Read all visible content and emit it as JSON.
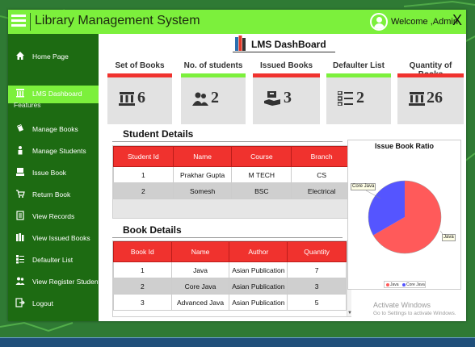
{
  "app": {
    "title": "Library Management System",
    "welcome": "Welcome ,Admin",
    "close": "X"
  },
  "sidebar": {
    "features_label": "Features",
    "items": [
      {
        "label": "Home Page",
        "icon": "home-icon"
      },
      {
        "label": "LMS Dashboard",
        "icon": "library-icon",
        "active": true
      },
      {
        "label": "Manage Books",
        "icon": "book-icon"
      },
      {
        "label": "Manage Students",
        "icon": "student-icon"
      },
      {
        "label": "Issue Book",
        "icon": "issue-icon"
      },
      {
        "label": "Return Book",
        "icon": "cart-icon"
      },
      {
        "label": "View Records",
        "icon": "records-icon"
      },
      {
        "label": "View Issued Books",
        "icon": "books-icon"
      },
      {
        "label": "Defaulter List",
        "icon": "list-icon"
      },
      {
        "label": "View Register Students",
        "icon": "users-icon"
      },
      {
        "label": "Logout",
        "icon": "logout-icon"
      }
    ]
  },
  "dashboard": {
    "title": "LMS  DashBoard"
  },
  "cards": [
    {
      "title": "Set of Books",
      "value": "6",
      "bar_color": "#f0322e",
      "icon": "library-icon"
    },
    {
      "title": "No. of students",
      "value": "2",
      "bar_color": "#7cf03c",
      "icon": "users-icon"
    },
    {
      "title": "Issued Books",
      "value": "3",
      "bar_color": "#f0322e",
      "icon": "issue-icon"
    },
    {
      "title": "Defaulter List",
      "value": "2",
      "bar_color": "#7cf03c",
      "icon": "list-icon"
    },
    {
      "title": "Quantity of Books",
      "value": "26",
      "bar_color": "#f0322e",
      "icon": "library-icon"
    }
  ],
  "student_details": {
    "title": "Student  Details",
    "columns": [
      "Student Id",
      "Name",
      "Course",
      "Branch"
    ],
    "rows": [
      [
        "1",
        "Prakhar Gupta",
        "M TECH",
        "CS"
      ],
      [
        "2",
        "Somesh",
        "BSC",
        "Electrical"
      ]
    ]
  },
  "book_details": {
    "title": "Book  Details",
    "columns": [
      "Book Id",
      "Name",
      "Author",
      "Quantity"
    ],
    "rows": [
      [
        "1",
        "Java",
        "Asian Publication",
        "7"
      ],
      [
        "2",
        "Core Java",
        "Asian Publication",
        "3"
      ],
      [
        "3",
        "Advanced Java",
        "Asian Publication",
        "5"
      ]
    ]
  },
  "chart_data": {
    "type": "pie",
    "title": "Issue Book Ratio",
    "categories": [
      "Java",
      "Core Java"
    ],
    "values": [
      2,
      1
    ],
    "colors": [
      "#ff5a5a",
      "#5555ff"
    ]
  },
  "watermark": {
    "line1": "Activate Windows",
    "line2": "Go to Settings to activate Windows."
  },
  "colors": {
    "accent_green": "#7cf03c",
    "sidebar_green": "#1d6b12",
    "header_red": "#f0322e"
  }
}
